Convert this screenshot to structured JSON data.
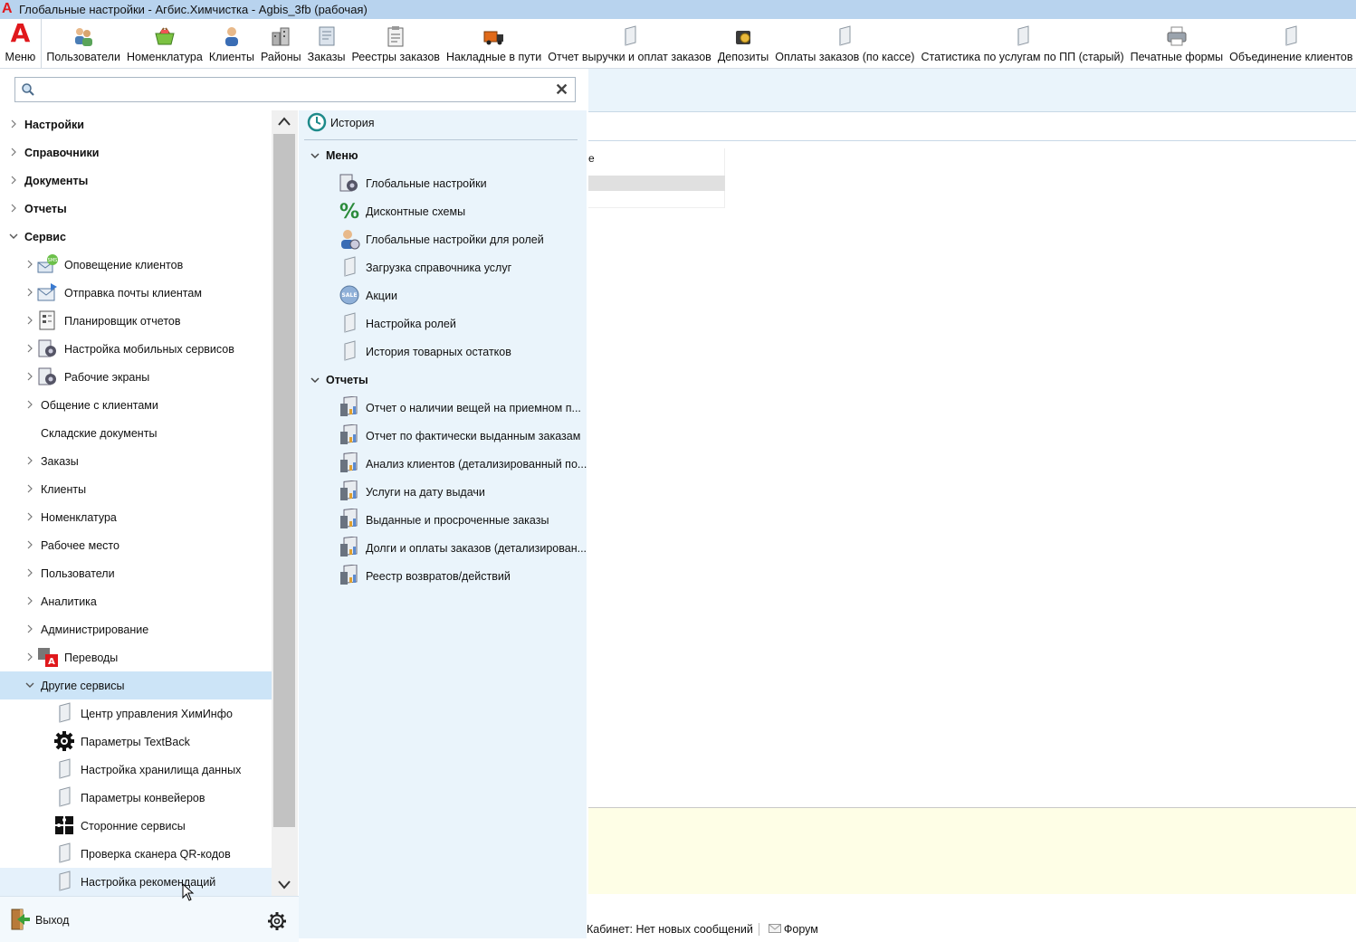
{
  "window": {
    "title": "Глобальные настройки - Агбис.Химчистка - Agbis_3fb (рабочая)"
  },
  "toolbar": {
    "menu_label": "Меню",
    "items": [
      {
        "label": "Пользователи",
        "icon": "users-icon"
      },
      {
        "label": "Номенклатура",
        "icon": "basket-icon"
      },
      {
        "label": "Клиенты",
        "icon": "client-icon"
      },
      {
        "label": "Районы",
        "icon": "districts-icon"
      },
      {
        "label": "Заказы",
        "icon": "orders-icon"
      },
      {
        "label": "Реестры заказов",
        "icon": "clipboard-icon"
      },
      {
        "label": "Накладные в пути",
        "icon": "truck-icon"
      },
      {
        "label": "Отчет выручки и оплат заказов",
        "icon": "document-icon"
      },
      {
        "label": "Депозиты",
        "icon": "deposit-icon"
      },
      {
        "label": "Оплаты заказов (по кассе)",
        "icon": "document-icon"
      },
      {
        "label": "Статистика по услугам по ПП (старый)",
        "icon": "document-icon"
      },
      {
        "label": "Печатные формы",
        "icon": "printer-icon"
      },
      {
        "label": "Объединение клиентов",
        "icon": "document-icon"
      }
    ]
  },
  "search": {
    "placeholder": ""
  },
  "nav": {
    "top": [
      {
        "label": "Настройки"
      },
      {
        "label": "Справочники"
      },
      {
        "label": "Документы"
      },
      {
        "label": "Отчеты"
      },
      {
        "label": "Сервис"
      }
    ],
    "service_items": [
      {
        "label": "Оповещение клиентов",
        "icon": "sms-icon",
        "chev": true
      },
      {
        "label": "Отправка почты клиентам",
        "icon": "mail-icon",
        "chev": true
      },
      {
        "label": "Планировщик отчетов",
        "icon": "scheduler-icon",
        "chev": true
      },
      {
        "label": "Настройка мобильных сервисов",
        "icon": "gear-doc-icon",
        "chev": true
      },
      {
        "label": "Рабочие экраны",
        "icon": "gear-doc-icon",
        "chev": true
      },
      {
        "label": "Общение с клиентами",
        "icon": "",
        "chev": true
      },
      {
        "label": "Складские документы",
        "icon": "",
        "chev": false
      },
      {
        "label": "Заказы",
        "icon": "",
        "chev": true
      },
      {
        "label": "Клиенты",
        "icon": "",
        "chev": true
      },
      {
        "label": "Номенклатура",
        "icon": "",
        "chev": true
      },
      {
        "label": "Рабочее место",
        "icon": "",
        "chev": true
      },
      {
        "label": "Пользователи",
        "icon": "",
        "chev": true
      },
      {
        "label": "Аналитика",
        "icon": "",
        "chev": true
      },
      {
        "label": "Администрирование",
        "icon": "",
        "chev": true
      },
      {
        "label": "Переводы",
        "icon": "translate-icon",
        "chev": true
      },
      {
        "label": "Другие сервисы",
        "icon": "",
        "chev": true
      }
    ],
    "other_services": [
      {
        "label": "Центр управления ХимИнфо",
        "icon": "document-icon"
      },
      {
        "label": "Параметры TextBack",
        "icon": "gear-icon"
      },
      {
        "label": "Настройка хранилища данных",
        "icon": "document-icon"
      },
      {
        "label": "Параметры конвейеров",
        "icon": "document-icon"
      },
      {
        "label": "Сторонние сервисы",
        "icon": "puzzle-icon"
      },
      {
        "label": "Проверка сканера QR-кодов",
        "icon": "document-icon"
      },
      {
        "label": "Настройка рекомендаций",
        "icon": "document-icon"
      }
    ]
  },
  "menu_panel": {
    "history_label": "История",
    "menu_group": "Меню",
    "menu_items": [
      {
        "label": "Глобальные настройки",
        "icon": "gear-doc-icon"
      },
      {
        "label": "Дисконтные схемы",
        "icon": "percent-icon"
      },
      {
        "label": "Глобальные настройки для ролей",
        "icon": "role-icon"
      },
      {
        "label": "Загрузка справочника услуг",
        "icon": "document-icon"
      },
      {
        "label": "Акции",
        "icon": "sale-icon"
      },
      {
        "label": "Настройка ролей",
        "icon": "document-icon"
      },
      {
        "label": "История товарных остатков",
        "icon": "document-icon"
      }
    ],
    "reports_group": "Отчеты",
    "report_items": [
      {
        "label": "Отчет о наличии вещей на приемном п..."
      },
      {
        "label": "Отчет по фактически выданным заказам"
      },
      {
        "label": "Анализ клиентов (детализированный по..."
      },
      {
        "label": "Услуги на дату выдачи"
      },
      {
        "label": "Выданные и просроченные заказы"
      },
      {
        "label": "Долги и оплаты заказов (детализирован..."
      },
      {
        "label": "Реестр возвратов/действий"
      }
    ]
  },
  "bottom": {
    "exit_label": "Выход"
  },
  "right": {
    "fragment_text": "е"
  },
  "status": {
    "cabinet": "Кабинет: Нет новых сообщений",
    "forum": "Форум"
  }
}
